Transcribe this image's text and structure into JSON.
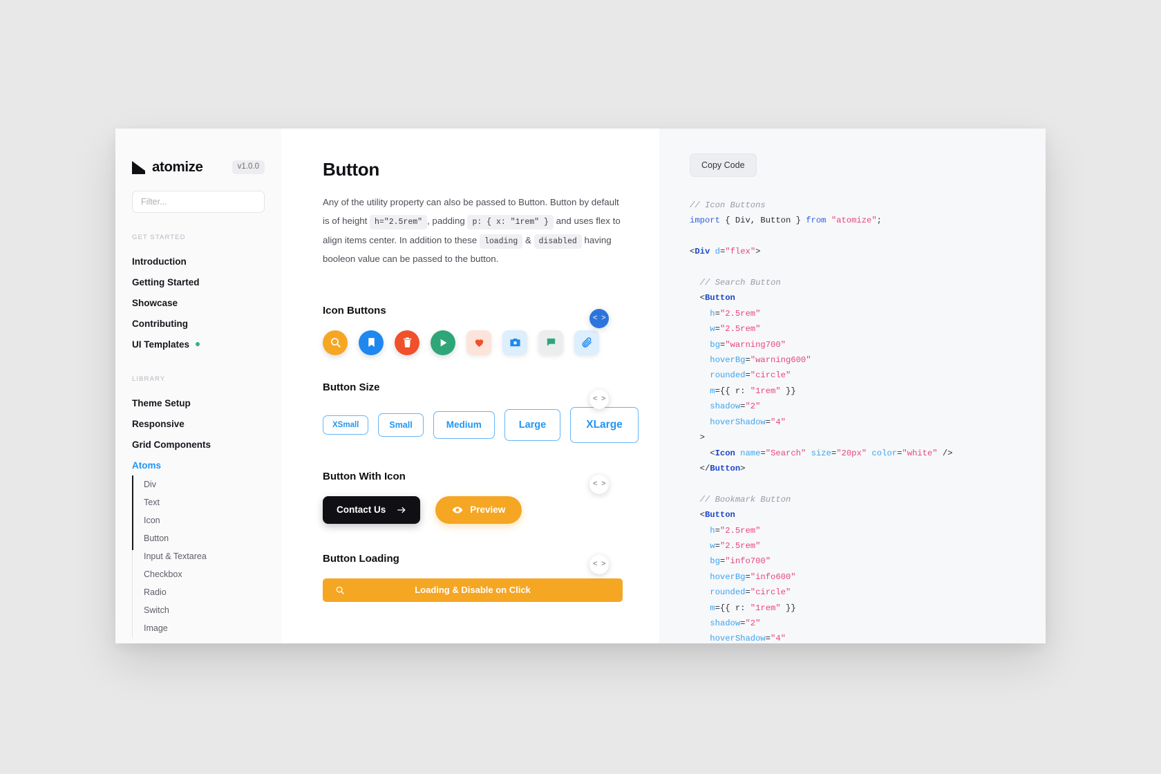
{
  "sidebar": {
    "brand": {
      "name": "atomize",
      "logo_icon": "atomize-logo-icon",
      "version": "v1.0.0"
    },
    "filter": {
      "placeholder": "Filter...",
      "value": ""
    },
    "sections": [
      {
        "title": "GET STARTED",
        "items": [
          {
            "label": "Introduction",
            "active": false,
            "dot": false
          },
          {
            "label": "Getting Started",
            "active": false,
            "dot": false
          },
          {
            "label": "Showcase",
            "active": false,
            "dot": false
          },
          {
            "label": "Contributing",
            "active": false,
            "dot": false
          },
          {
            "label": "UI Templates",
            "active": false,
            "dot": true
          }
        ]
      },
      {
        "title": "LIBRARY",
        "items": [
          {
            "label": "Theme Setup",
            "active": false,
            "dot": false
          },
          {
            "label": "Responsive",
            "active": false,
            "dot": false
          },
          {
            "label": "Grid Components",
            "active": false,
            "dot": false
          },
          {
            "label": "Atoms",
            "active": true,
            "dot": false
          }
        ]
      }
    ],
    "sub_items": [
      {
        "label": "Div"
      },
      {
        "label": "Text"
      },
      {
        "label": "Icon"
      },
      {
        "label": "Button"
      },
      {
        "label": "Input & Textarea"
      },
      {
        "label": "Checkbox"
      },
      {
        "label": "Radio"
      },
      {
        "label": "Switch"
      },
      {
        "label": "Image"
      }
    ],
    "dot_color": "#34b37e",
    "active_color": "#2196f3"
  },
  "main": {
    "title": "Button",
    "description": {
      "part1": "Any of the utility property can also be passed to Button. Button by default is of height",
      "chip1": "h=\"2.5rem\"",
      "part2": ", padding",
      "chip2": "p: { x: \"1rem\" }",
      "part3": "and uses flex to align items center. In addition to these",
      "chip3": "loading",
      "part4": "&",
      "chip4": "disabled",
      "part5": "having booleon value can be passed to the button."
    },
    "sections": {
      "icon_buttons": {
        "title": "Icon Buttons",
        "buttons": [
          {
            "icon": "search-icon",
            "bg": "#f5a623",
            "fg": "#ffffff",
            "shape": "circle"
          },
          {
            "icon": "bookmark-icon",
            "bg": "#1e88f0",
            "fg": "#ffffff",
            "shape": "circle"
          },
          {
            "icon": "trash-icon",
            "bg": "#f0502a",
            "fg": "#ffffff",
            "shape": "circle"
          },
          {
            "icon": "play-icon",
            "bg": "#2fa678",
            "fg": "#ffffff",
            "shape": "circle"
          },
          {
            "icon": "heart-icon",
            "bg": "#fde4da",
            "fg": "#f0502a",
            "shape": "rounded"
          },
          {
            "icon": "camera-icon",
            "bg": "#ddeefc",
            "fg": "#1e88f0",
            "shape": "rounded"
          },
          {
            "icon": "flag-icon",
            "bg": "#ebedee",
            "fg": "#2fa678",
            "shape": "rounded"
          },
          {
            "icon": "attach-icon",
            "bg": "#ddeefc",
            "fg": "#1e88f0",
            "shape": "rounded"
          }
        ],
        "toggle": {
          "label": "< >",
          "active": true
        }
      },
      "button_size": {
        "title": "Button Size",
        "buttons": [
          {
            "label": "XSmall",
            "size": "xs"
          },
          {
            "label": "Small",
            "size": "sm"
          },
          {
            "label": "Medium",
            "size": "md"
          },
          {
            "label": "Large",
            "size": "lg"
          },
          {
            "label": "XLarge",
            "size": "xl"
          }
        ],
        "toggle": {
          "label": "< >",
          "active": false
        }
      },
      "button_with_icon": {
        "title": "Button With Icon",
        "contact": {
          "label": "Contact Us",
          "icon": "arrow-right-icon"
        },
        "preview": {
          "label": "Preview",
          "icon": "eye-icon"
        },
        "toggle": {
          "label": "< >",
          "active": false
        }
      },
      "button_loading": {
        "title": "Button Loading",
        "button": {
          "label": "Loading & Disable on Click",
          "icon": "search-icon"
        },
        "toggle": {
          "label": "< >",
          "active": false
        }
      }
    }
  },
  "code_panel": {
    "copy_label": "Copy Code",
    "source": "// Icon Buttons\nimport { Div, Button } from \"atomize\";\n\n<Div d=\"flex\">\n\n  // Search Button\n  <Button\n    h=\"2.5rem\"\n    w=\"2.5rem\"\n    bg=\"warning700\"\n    hoverBg=\"warning600\"\n    rounded=\"circle\"\n    m={{ r: \"1rem\" }}\n    shadow=\"2\"\n    hoverShadow=\"4\"\n  >\n    <Icon name=\"Search\" size=\"20px\" color=\"white\" />\n  </Button>\n\n  // Bookmark Button\n  <Button\n    h=\"2.5rem\"\n    w=\"2.5rem\"\n    bg=\"info700\"\n    hoverBg=\"info600\"\n    rounded=\"circle\"\n    m={{ r: \"1rem\" }}\n    shadow=\"2\"\n    hoverShadow=\"4\""
  }
}
